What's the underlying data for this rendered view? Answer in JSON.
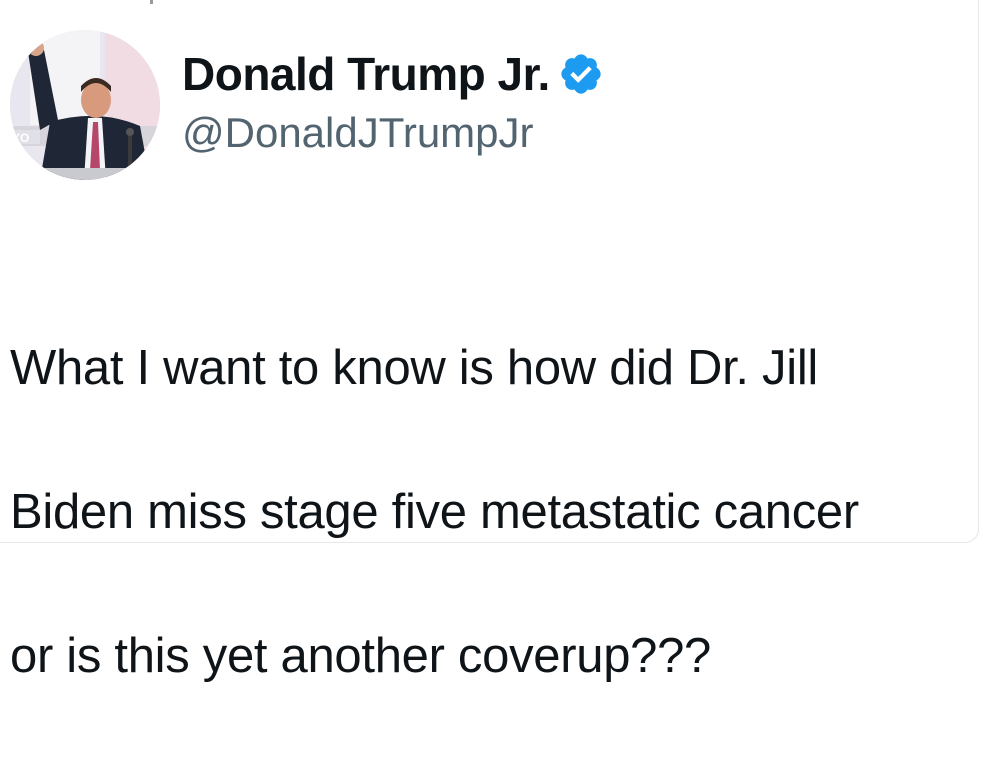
{
  "tweet": {
    "author": {
      "display_name": "Donald Trump Jr.",
      "handle": "@DonaldJTrumpJr",
      "verified": true,
      "verified_icon": "verified-badge-icon",
      "verified_color": "#1d9bf0"
    },
    "text_lines": [
      "What I want to know is how did Dr. Jill",
      "Biden miss stage five metastatic cancer",
      "or is this yet another coverup???"
    ]
  }
}
